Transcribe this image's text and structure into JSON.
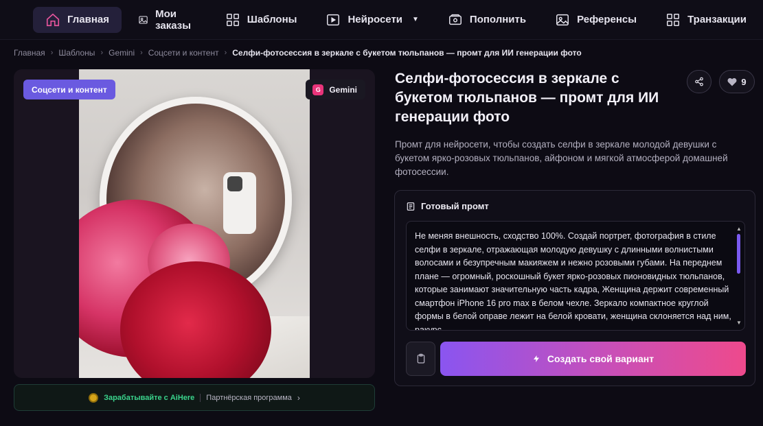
{
  "nav": {
    "items": [
      {
        "label": "Главная",
        "icon": "home-icon",
        "active": true
      },
      {
        "label": "Мои заказы",
        "icon": "image-icon"
      },
      {
        "label": "Шаблоны",
        "icon": "grid-icon"
      },
      {
        "label": "Нейросети",
        "icon": "play-icon",
        "dropdown": true
      },
      {
        "label": "Пополнить",
        "icon": "wallet-icon"
      },
      {
        "label": "Референсы",
        "icon": "image-icon"
      },
      {
        "label": "Транзакции",
        "icon": "grid-icon"
      }
    ]
  },
  "breadcrumb": {
    "items": [
      "Главная",
      "Шаблоны",
      "Gemini",
      "Соцсети и контент"
    ],
    "current": "Селфи-фотосессия в зеркале с букетом тюльпанов — промт для ИИ генерации фото",
    "separator": "›"
  },
  "card": {
    "category": "Соцсети и контент",
    "model": "Gemini",
    "model_icon_letter": "G"
  },
  "partner": {
    "earn": "Зарабатывайте с AiHere",
    "program": "Партнёрская программа"
  },
  "template": {
    "title": "Селфи-фотосессия в зеркале с букетом тюльпанов — промт для ИИ генерации фото",
    "likes": "9",
    "description": "Промт для нейросети, чтобы создать селфи в зеркале молодой девушки с букетом ярко-розовых тюльпанов, айфоном и мягкой атмосферой домашней фотосессии."
  },
  "prompt": {
    "heading": "Готовый промт",
    "text": "Не меняя внешность, сходство 100%. Создай портрет, фотография в стиле селфи в зеркале, отражающая молодую девушку с длинными волнистыми  волосами и безупречным макияжем и нежно розовыми губами. На переднем плане — огромный, роскошный букет ярко-розовых пионовидных тюльпанов, которые занимают значительную часть кадра, Женщина держит современный смартфон iPhone 16 pro max в белом чехле. Зеркало компактное круглой формы в белой оправе лежит на белой кровати, женщина склоняется над ним, ракурс",
    "create_label": "Создать свой вариант"
  },
  "colors": {
    "accent": "#6a5ae0",
    "gradient_start": "#8a55f0",
    "gradient_end": "#ee4a8c",
    "partner_green": "#3ad48c"
  }
}
